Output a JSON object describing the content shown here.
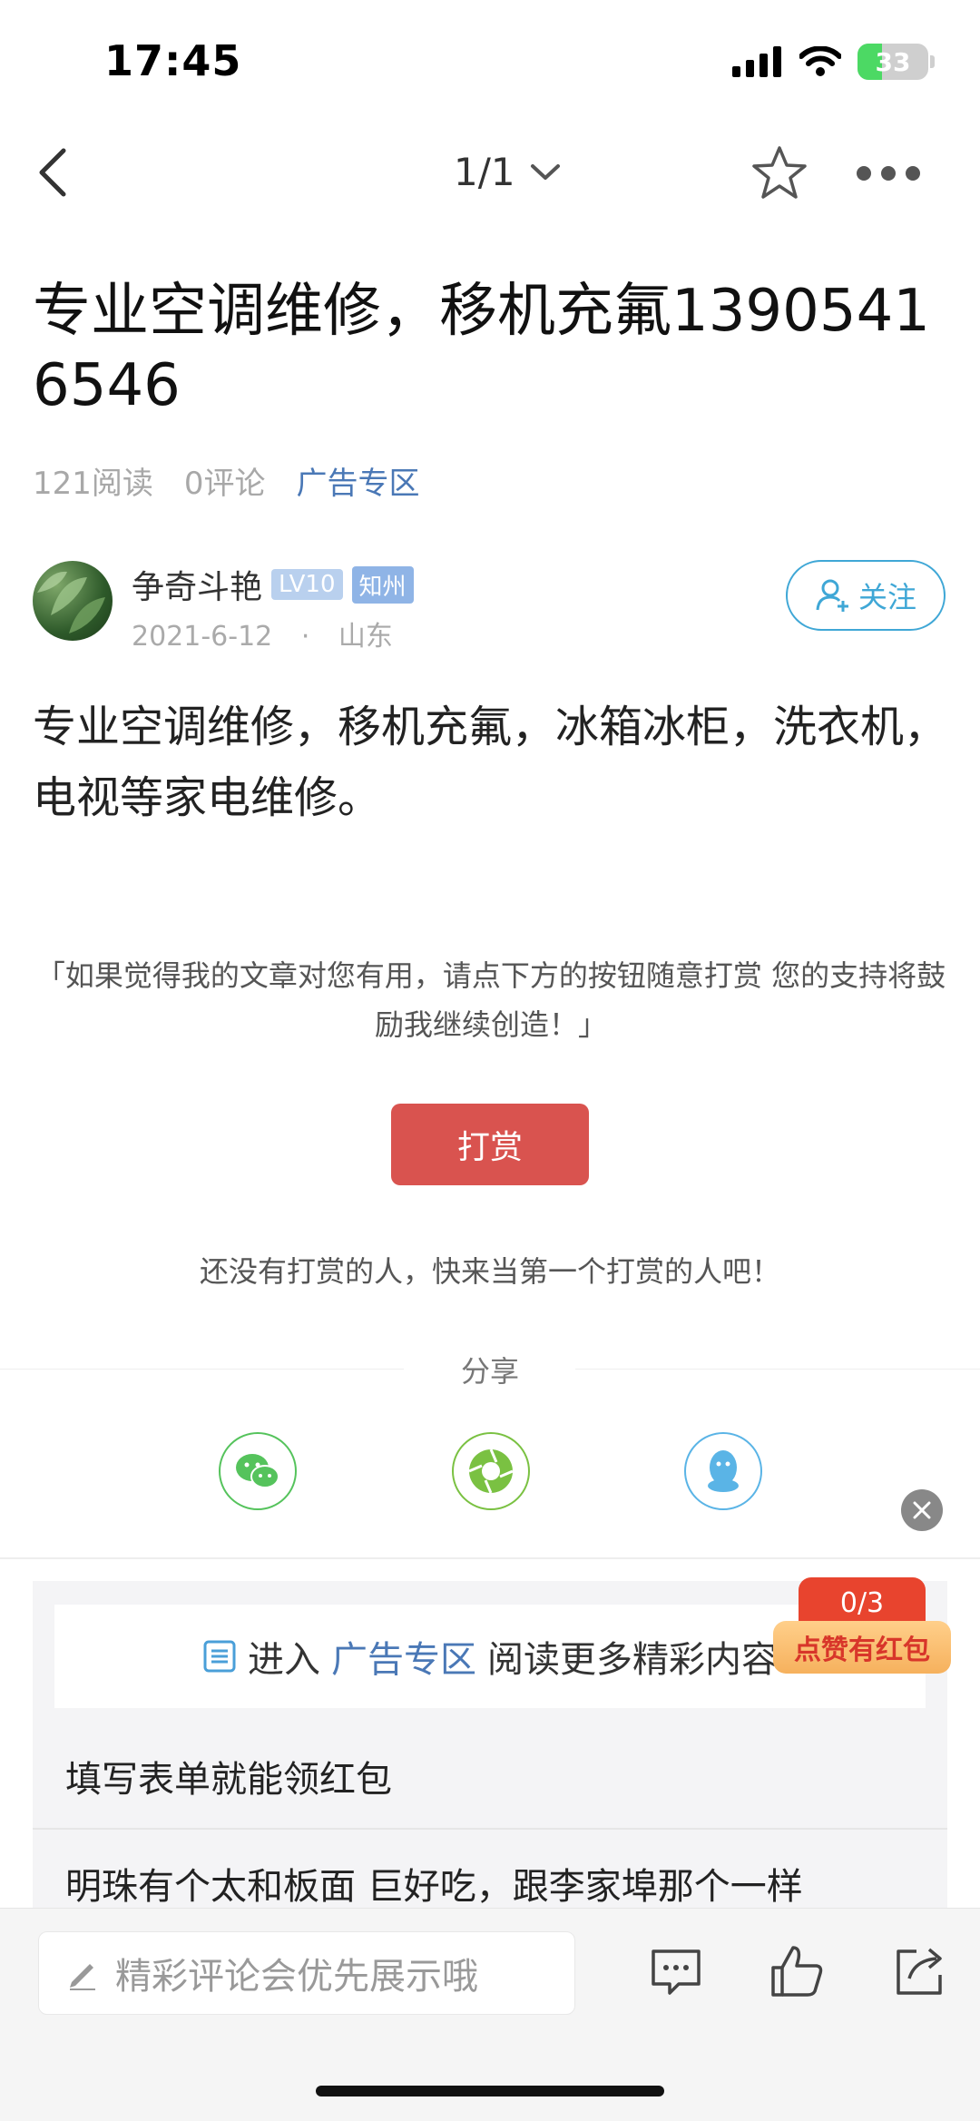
{
  "status": {
    "time": "17:45",
    "battery": "33"
  },
  "nav": {
    "pager": "1/1"
  },
  "article": {
    "title": "专业空调维修，移机充氟13905416546",
    "reads": "121阅读",
    "comments": "0评论",
    "category": "广告专区",
    "body": "专业空调维修，移机充氟，冰箱冰柜，洗衣机，电视等家电维修。"
  },
  "author": {
    "name": "争奇斗艳",
    "level": "LV10",
    "area": "知州",
    "date": "2021-6-12",
    "sep": "·",
    "location": "山东",
    "follow_label": "关注"
  },
  "reward": {
    "note": "「如果觉得我的文章对您有用，请点下方的按钮随意打赏 您的支持将鼓励我继续创造！」",
    "button": "打赏",
    "empty": "还没有打赏的人，快来当第一个打赏的人吧！"
  },
  "share": {
    "label": "分享",
    "targets": [
      "wechat-icon",
      "moments-icon",
      "qq-icon"
    ]
  },
  "related": {
    "enter": "进入",
    "category": "广告专区",
    "more": "阅读更多精彩内容",
    "items": [
      "填写表单就能领红包",
      "明珠有个太和板面 巨好吃，跟李家埠那个一样"
    ]
  },
  "redpack": {
    "count": "0/3",
    "label": "点赞有红包"
  },
  "bottom": {
    "placeholder": "精彩评论会优先展示哦"
  },
  "colors": {
    "accent": "#3fa7d6",
    "link": "#4a78b6",
    "reward": "#d9534f"
  }
}
